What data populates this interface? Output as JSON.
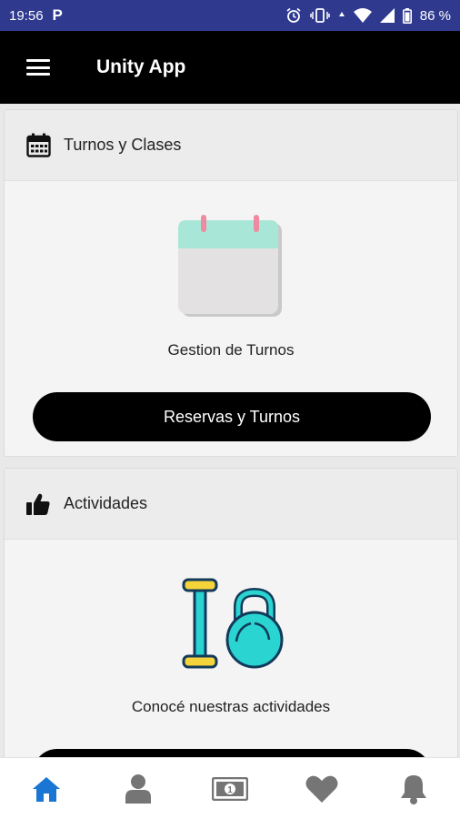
{
  "status_bar": {
    "time": "19:56",
    "app_letter": "P",
    "battery": "86 %"
  },
  "app_bar": {
    "title": "Unity App",
    "menu_icon": "hamburger-menu-icon"
  },
  "cards": [
    {
      "header_icon": "calendar-icon",
      "header_title": "Turnos y Clases",
      "illustration": "calendar-illustration",
      "caption": "Gestion de Turnos",
      "button_label": "Reservas y Turnos"
    },
    {
      "header_icon": "thumbs-up-icon",
      "header_title": "Actividades",
      "illustration": "dumbbell-kettlebell-illustration",
      "caption": "Conocé nuestras actividades",
      "button_label": ""
    }
  ],
  "bottom_nav": {
    "items": [
      "home-icon",
      "user-icon",
      "money-icon",
      "heart-icon",
      "bell-icon"
    ],
    "active_index": 0,
    "active_color": "#1976d2",
    "inactive_color": "#757575"
  },
  "colors": {
    "status_bar": "#2f3a8f",
    "app_bar": "#000000",
    "button": "#000000",
    "calendar_top": "#a8e6d8",
    "calendar_pins": "#f08aa0",
    "dumbbell_fill": "#2ad4d0",
    "dumbbell_accent": "#f5d33a"
  }
}
